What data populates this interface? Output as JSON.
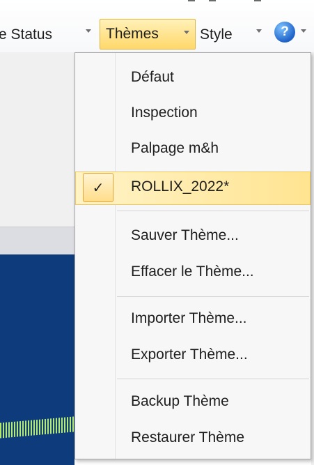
{
  "toolbar": {
    "status_label": "e Status",
    "themes_label": "Thèmes",
    "style_label": "Style",
    "help_glyph": "?"
  },
  "menu": {
    "items": [
      {
        "label": "Défaut"
      },
      {
        "label": "Inspection"
      },
      {
        "label": "Palpage m&h"
      },
      {
        "label": "ROLLIX_2022*",
        "checked": true,
        "check_glyph": "✓"
      },
      {
        "label": "Sauver Thème..."
      },
      {
        "label": "Effacer le Thème..."
      },
      {
        "label": "Importer Thème..."
      },
      {
        "label": "Exporter Thème..."
      },
      {
        "label": "Backup Thème"
      },
      {
        "label": "Restaurer Thème"
      }
    ]
  },
  "colors": {
    "highlight": "#ffe491",
    "highlight_border": "#f0c861",
    "viewport_blue": "#0e3b7c",
    "accent_green": "#c6ff6a"
  },
  "icons": {
    "help": "help-icon",
    "dropdown": "chevron-down-icon",
    "check": "check-icon"
  }
}
